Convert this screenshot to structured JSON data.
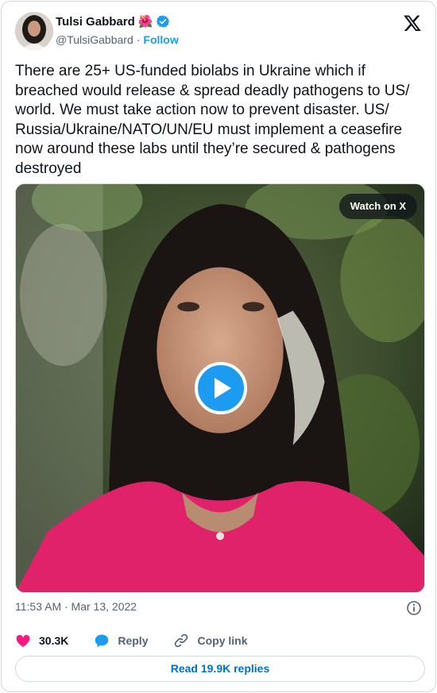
{
  "author": {
    "name": "Tulsi Gabbard",
    "emoji": "🌺",
    "handle": "@TulsiGabbard",
    "separator": "·",
    "follow_label": "Follow"
  },
  "tweet": {
    "text": "There are 25+ US-funded biolabs in Ukraine which if breached would release & spread deadly pathogens to US/ world. We must take action now to prevent disaster. US/ Russia/Ukraine/NATO/UN/EU must implement a ceasefire now around these labs until they’re secured & pathogens destroyed",
    "timestamp": "11:53 AM · Mar 13, 2022"
  },
  "media": {
    "watch_label": "Watch on X"
  },
  "actions": {
    "likes": "30.3K",
    "reply_label": "Reply",
    "copy_label": "Copy link"
  },
  "replies_button": "Read 19.9K replies",
  "colors": {
    "accent": "#1d9bf0",
    "like": "#f91880",
    "text": "#0f1419",
    "muted": "#536471",
    "border": "#cfd9de"
  },
  "icons": [
    "verified-badge-icon",
    "x-logo-icon",
    "play-icon",
    "info-icon",
    "heart-icon",
    "reply-bubble-icon",
    "link-icon"
  ]
}
